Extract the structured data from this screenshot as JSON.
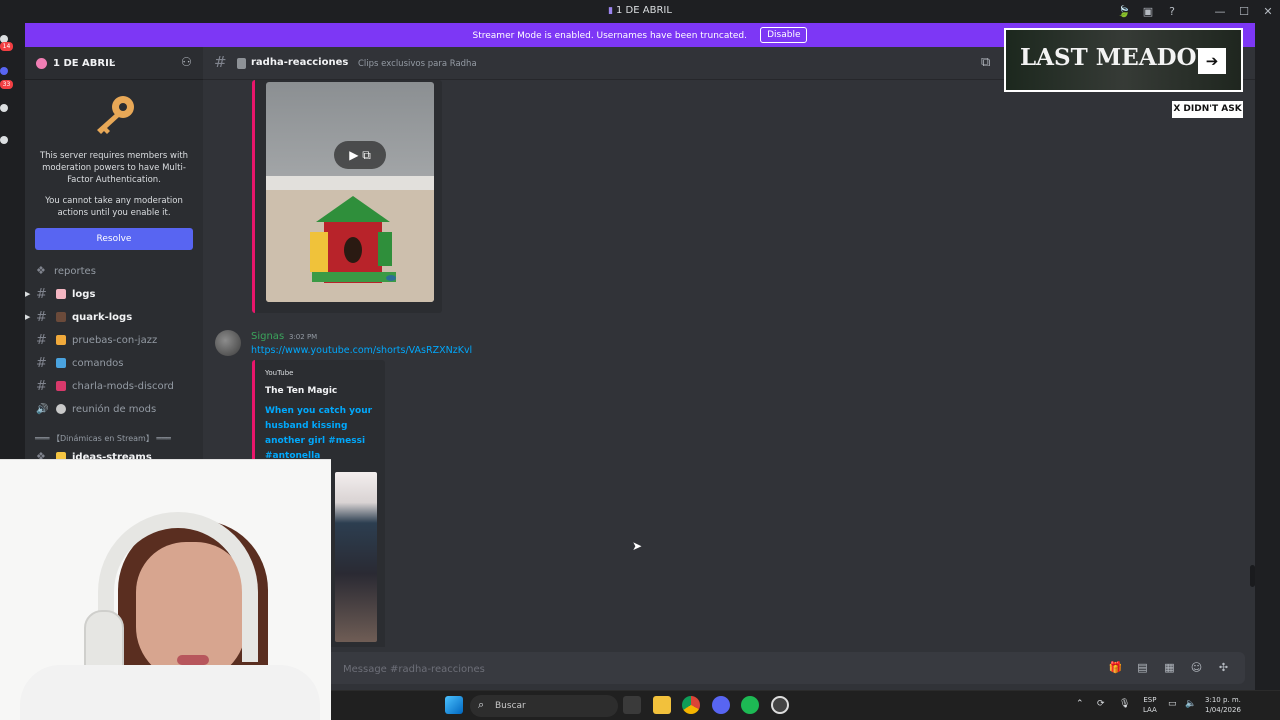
{
  "window": {
    "title": "1 DE ABRIL"
  },
  "rail": {
    "badges": [
      "14",
      "33"
    ]
  },
  "banner": {
    "text": "Streamer Mode is enabled. Usernames have been truncated.",
    "button": "Disable",
    "color": "#7d37f5"
  },
  "server": {
    "name": "1 DE ABRIL"
  },
  "mfa": {
    "text1": "This server requires members with moderation powers to have Multi-Factor Authentication.",
    "text2": "You cannot take any moderation actions until you enable it.",
    "button": "Resolve"
  },
  "channels": [
    {
      "label": "reportes",
      "emoji_color": "#80848e",
      "icon": "forum-icon"
    },
    {
      "label": "logs",
      "emoji_color": "#f4b6c2",
      "active": true
    },
    {
      "label": "quark-logs",
      "emoji_color": "#6b4a3a",
      "active": true
    },
    {
      "label": "pruebas-con-jazz",
      "emoji_color": "#f0a93b"
    },
    {
      "label": "comandos",
      "emoji_color": "#4aa3df"
    },
    {
      "label": "charla-mods-discord",
      "emoji_color": "#d8396b"
    },
    {
      "label": "reunión de mods",
      "emoji_color": "#c9c9c9",
      "icon": "speaker-icon"
    },
    {
      "label": "ideas-streams",
      "emoji_color": "#f5c542",
      "active": true
    }
  ],
  "category": "═══ 【Dinámicas en Stream】 ═══",
  "chat": {
    "channel_name": "radha-reacciones",
    "topic": "Clips exclusivos para Radha",
    "placeholder": "Message #radha-reacciones"
  },
  "message": {
    "author": "Signas",
    "timestamp": "3:02 PM",
    "link": "https://www.youtube.com/shorts/VAsRZXNzKvl",
    "embed": {
      "provider": "YouTube",
      "title": "The Ten Magic",
      "description": "When you catch your husband kissing another girl #messi #antonella"
    }
  },
  "taskbar": {
    "search": "Buscar",
    "lang1": "ESP",
    "lang2": "LAA",
    "time": "3:10 p. m.",
    "date": "1/04/2026"
  },
  "overlay": {
    "meadow": "LAST MEADOW",
    "tag": "X DIDN'T ASK"
  }
}
